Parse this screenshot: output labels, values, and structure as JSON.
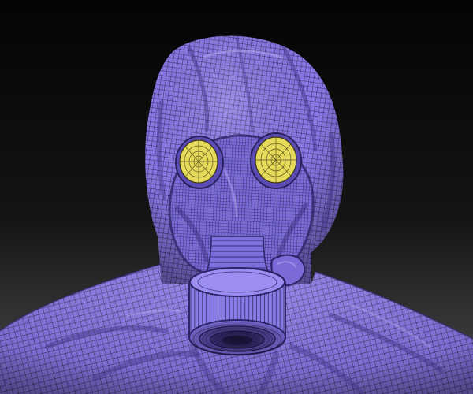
{
  "scene": {
    "subject": "gas-mask-hood-sculpt",
    "colors": {
      "background_top": "#040404",
      "background_bottom": "#4a4a4a",
      "mesh_fill": "#8878e6",
      "mesh_fill_light": "#a99cf2",
      "mesh_fill_dark": "#4e409e",
      "mesh_wire": "#1a1530",
      "lens_fill": "#e6da5a",
      "lens_wire": "#3a3510"
    }
  }
}
